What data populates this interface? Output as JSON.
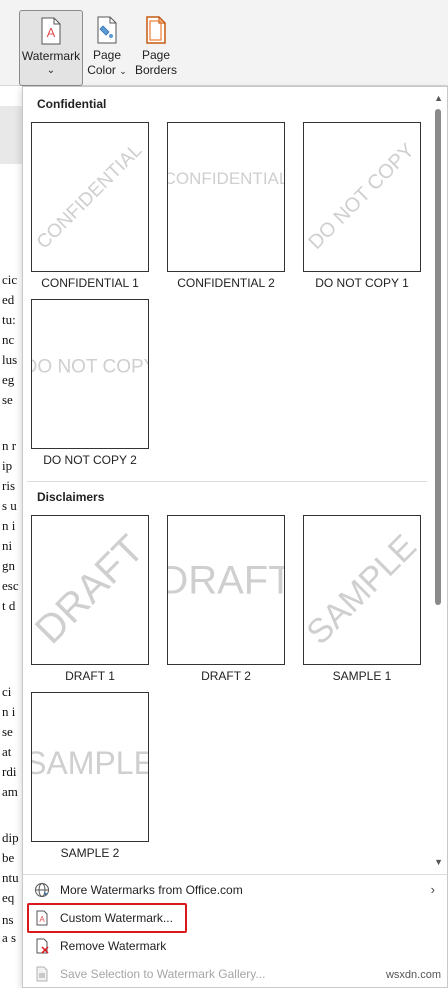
{
  "ribbon": {
    "watermark_label": "Watermark",
    "page_color_line1": "Page",
    "page_color_line2": "Color",
    "page_borders_line1": "Page",
    "page_borders_line2": "Borders",
    "chevron": "⌄"
  },
  "background_doc": {
    "lines": [
      "cic",
      "ed",
      "tu:",
      "nc",
      "lus",
      "eg",
      "se",
      "n r",
      "ip",
      "ris",
      "s u",
      "n i",
      "ni",
      "gn",
      "esc",
      "t d",
      "ci",
      "n i",
      "se",
      "at",
      "rdi",
      "am",
      "dip",
      "be",
      "ntu",
      "eq",
      "ns",
      "a s"
    ]
  },
  "gallery": {
    "sections": [
      {
        "header": "Confidential",
        "items": [
          {
            "label": "CONFIDENTIAL 1",
            "watermark": "CONFIDENTIAL",
            "style": "diagonal-small"
          },
          {
            "label": "CONFIDENTIAL 2",
            "watermark": "CONFIDENTIAL",
            "style": "horizontal-small"
          },
          {
            "label": "DO NOT COPY 1",
            "watermark": "DO NOT COPY",
            "style": "diagonal-small"
          },
          {
            "label": "DO NOT COPY 2",
            "watermark": "DO NOT COPY",
            "style": "horizontal-small"
          }
        ]
      },
      {
        "header": "Disclaimers",
        "items": [
          {
            "label": "DRAFT 1",
            "watermark": "DRAFT",
            "style": "diagonal-large"
          },
          {
            "label": "DRAFT 2",
            "watermark": "DRAFT",
            "style": "horizontal-large"
          },
          {
            "label": "SAMPLE 1",
            "watermark": "SAMPLE",
            "style": "diagonal-large"
          },
          {
            "label": "SAMPLE 2",
            "watermark": "SAMPLE",
            "style": "horizontal-large"
          }
        ]
      }
    ]
  },
  "menu": {
    "more_watermarks": "More Watermarks from Office.com",
    "custom_watermark": "Custom Watermark...",
    "remove_watermark": "Remove Watermark",
    "save_selection": "Save Selection to Watermark Gallery..."
  },
  "site_watermark": "wsxdn.com",
  "colors": {
    "highlight": "#d9181e",
    "watermark_text": "#cfcfcf",
    "ribbon_bg": "#f3f3f3"
  }
}
